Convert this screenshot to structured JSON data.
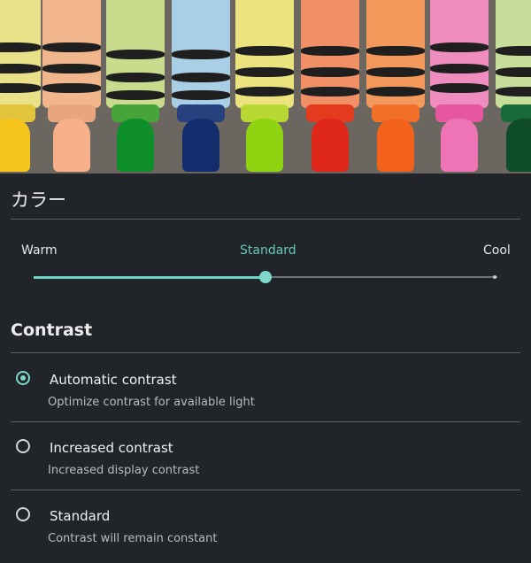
{
  "header": {
    "title": "カラー"
  },
  "slider": {
    "left_label": "Warm",
    "center_label": "Standard",
    "right_label": "Cool",
    "value": 0.5,
    "accent_color": "#7dd8cb"
  },
  "contrast": {
    "title": "Contrast",
    "options": [
      {
        "title": "Automatic contrast",
        "subtitle": "Optimize contrast for available light",
        "selected": true
      },
      {
        "title": "Increased contrast",
        "subtitle": "Increased display contrast",
        "selected": false
      },
      {
        "title": "Standard",
        "subtitle": "Contrast will remain constant",
        "selected": false
      }
    ]
  },
  "colors": {
    "background": "#212529",
    "accent": "#7dd8cb",
    "divider": "#5b6066"
  }
}
